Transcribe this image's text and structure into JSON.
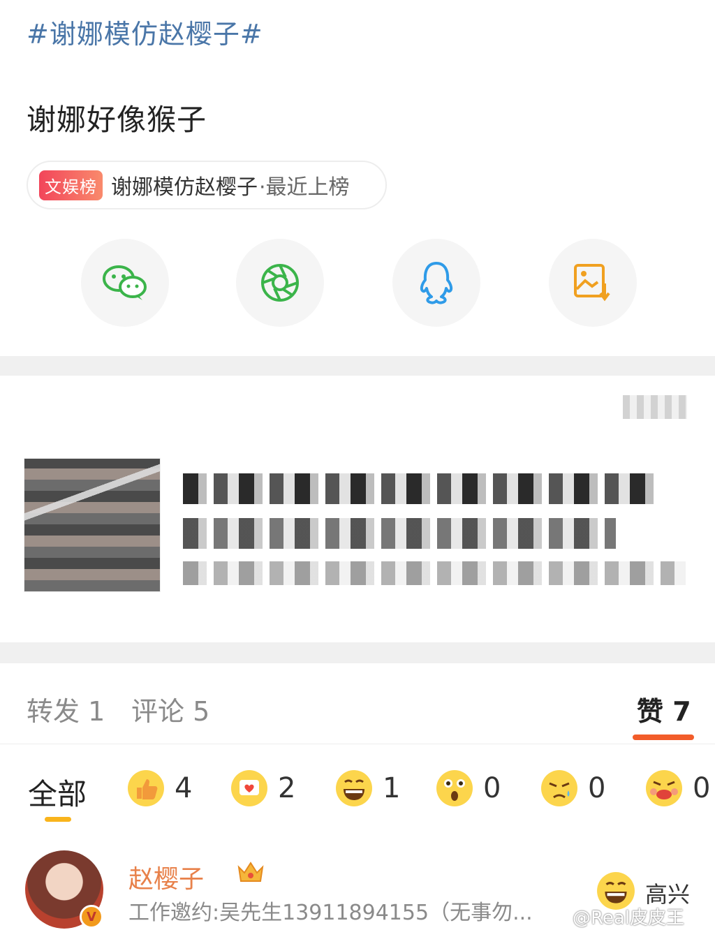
{
  "hashtag": "#谢娜模仿赵樱子#",
  "post_text": "谢娜好像猴子",
  "rank": {
    "badge": "文娱榜",
    "topic": "谢娜模仿赵樱子",
    "suffix": "·最近上榜"
  },
  "share": [
    {
      "icon": "wechat-icon",
      "color": "#3bb44a"
    },
    {
      "icon": "moments-icon",
      "color": "#3bb44a"
    },
    {
      "icon": "qq-icon",
      "color": "#2f9be8"
    },
    {
      "icon": "save-image-icon",
      "color": "#f0a020"
    }
  ],
  "tabs": {
    "repost_label": "转发",
    "repost_count": "1",
    "comment_label": "评论",
    "comment_count": "5",
    "like_label": "赞",
    "like_count": "7"
  },
  "reactions": {
    "all_label": "全部",
    "items": [
      {
        "icon": "thumbs-up-icon",
        "count": "4"
      },
      {
        "icon": "heart-icon",
        "count": "2"
      },
      {
        "icon": "happy-face-icon",
        "count": "1"
      },
      {
        "icon": "surprised-face-icon",
        "count": "0"
      },
      {
        "icon": "sad-face-icon",
        "count": "0"
      },
      {
        "icon": "angry-face-icon",
        "count": "0"
      }
    ]
  },
  "comment": {
    "name": "赵樱子",
    "bio": "工作邀约:吴先生13911894155（无事勿...",
    "reaction_label": "高兴",
    "watermark": "@Real皮皮王",
    "badge": "V"
  },
  "colors": {
    "accent": "#f25c2a",
    "hashtag": "#4a76a8",
    "name": "#e8814a"
  }
}
